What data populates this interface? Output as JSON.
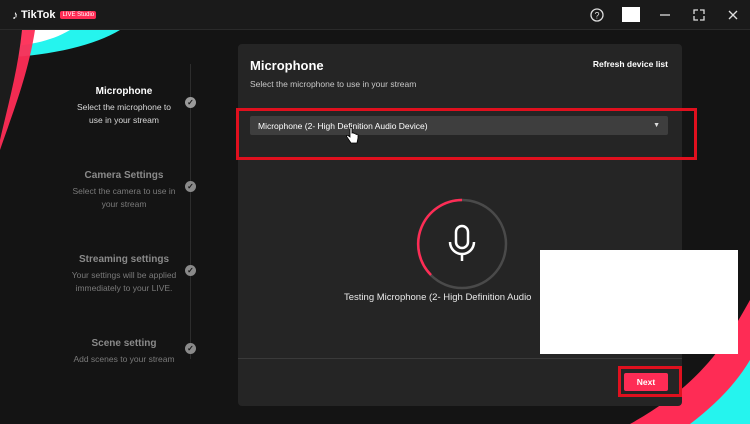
{
  "app": {
    "name": "TikTok",
    "badge": "LIVE Studio"
  },
  "titlebar": {
    "icons": [
      "help-icon",
      "minimize-icon",
      "maximize-icon",
      "close-icon"
    ]
  },
  "steps": [
    {
      "title": "Microphone",
      "desc_line1": "Select the microphone to",
      "desc_line2": "use in your stream",
      "state": "active"
    },
    {
      "title": "Camera Settings",
      "desc_line1": "Select the camera to use in",
      "desc_line2": "your stream",
      "state": "inactive"
    },
    {
      "title": "Streaming settings",
      "desc_line1": "Your settings will be applied",
      "desc_line2": "immediately to your LIVE.",
      "state": "inactive"
    },
    {
      "title": "Scene setting",
      "desc_line1": "Add scenes to your stream",
      "desc_line2": "",
      "state": "inactive"
    }
  ],
  "panel": {
    "title": "Microphone",
    "subtitle": "Select the microphone to use in your stream",
    "refresh_label": "Refresh device list",
    "device_selected": "Microphone (2- High Definition Audio Device)",
    "testing_text": "Testing Microphone (2- High Definition Audio",
    "next_label": "Next"
  },
  "colors": {
    "accent": "#fe2c55",
    "highlight": "#e0101e",
    "panel_bg": "#252525",
    "background": "#141414",
    "deco_cyan": "#25f4ee"
  }
}
